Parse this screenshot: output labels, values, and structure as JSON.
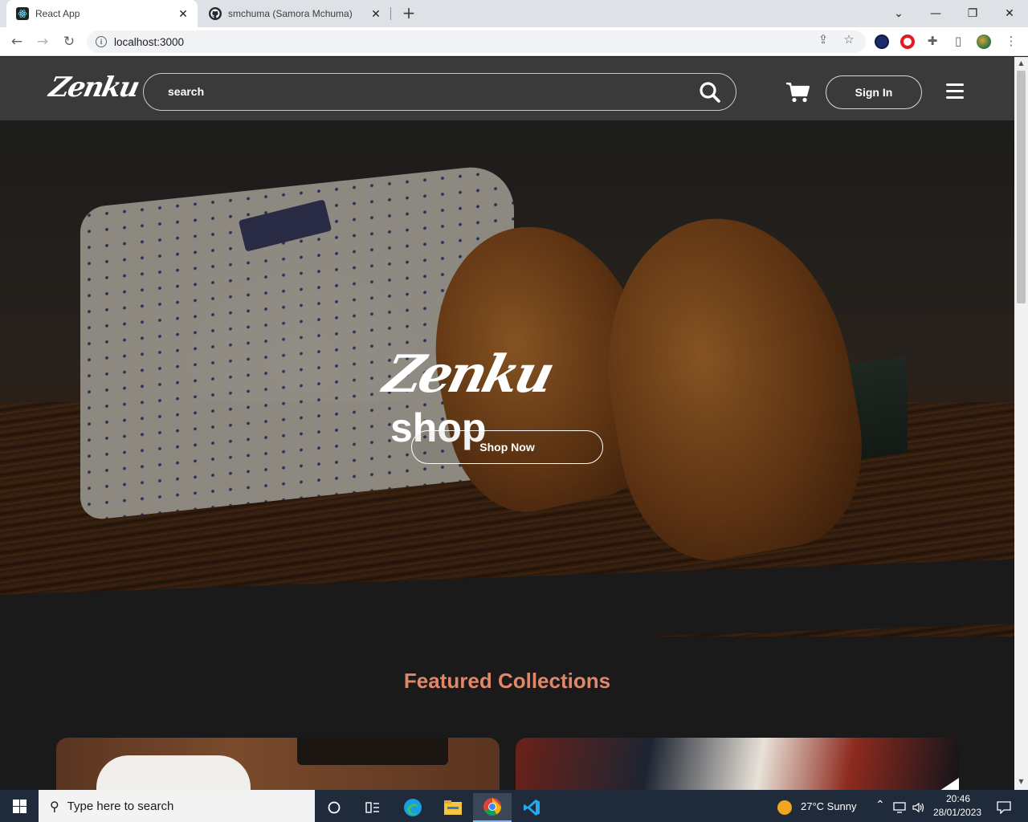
{
  "browser": {
    "tabs": [
      {
        "title": "React App",
        "active": true
      },
      {
        "title": "smchuma (Samora Mchuma)",
        "active": false
      }
    ],
    "url": "localhost:3000"
  },
  "site": {
    "logo": "Zenku",
    "search_placeholder": "search",
    "signin_label": "Sign In",
    "hero": {
      "brand": "Zenku",
      "word": "shop",
      "cta": "Shop Now"
    },
    "featured_title": "Featured Collections",
    "colors": {
      "navbar": "#3a3a3a",
      "page_bg": "#1a1a1a",
      "featured_heading": "#e0876a"
    }
  },
  "taskbar": {
    "search_placeholder": "Type here to search",
    "weather": "27°C  Sunny",
    "time": "20:46",
    "date": "28/01/2023"
  }
}
